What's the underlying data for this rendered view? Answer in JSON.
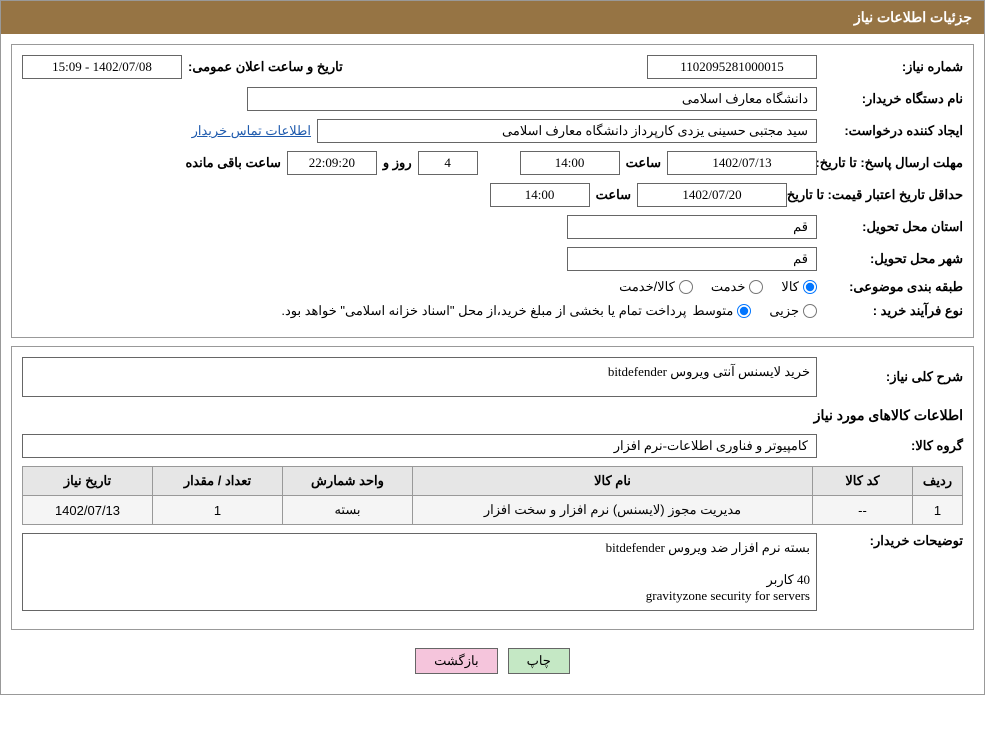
{
  "header": {
    "title": "جزئیات اطلاعات نیاز"
  },
  "info": {
    "request_no_label": "شماره نیاز:",
    "request_no": "1102095281000015",
    "announce_label": "تاریخ و ساعت اعلان عمومی:",
    "announce_value": "1402/07/08 - 15:09",
    "buyer_org_label": "نام دستگاه خریدار:",
    "buyer_org": "دانشگاه معارف اسلامی",
    "creator_label": "ایجاد کننده درخواست:",
    "creator": "سید مجتبی حسینی یزدی کارپرداز دانشگاه معارف اسلامی",
    "contact_link": "اطلاعات تماس خریدار",
    "reply_deadline_label": "مهلت ارسال پاسخ: تا تاریخ:",
    "reply_date": "1402/07/13",
    "time_label": "ساعت",
    "reply_time": "14:00",
    "days_label": "روز و",
    "days": "4",
    "remaining_time": "22:09:20",
    "remaining_label": "ساعت باقی مانده",
    "price_validity_label": "حداقل تاریخ اعتبار قیمت: تا تاریخ:",
    "price_date": "1402/07/20",
    "price_time": "14:00",
    "province_label": "استان محل تحویل:",
    "province": "قم",
    "city_label": "شهر محل تحویل:",
    "city": "قم",
    "category_label": "طبقه بندی موضوعی:",
    "radio_goods": "کالا",
    "radio_service": "خدمت",
    "radio_both": "کالا/خدمت",
    "buy_type_label": "نوع فرآیند خرید :",
    "radio_partial": "جزیی",
    "radio_medium": "متوسط",
    "buy_note": "پرداخت تمام یا بخشی از مبلغ خرید،از محل \"اسناد خزانه اسلامی\" خواهد بود."
  },
  "need": {
    "desc_label": "شرح کلی نیاز:",
    "desc": "خرید لایسنس آنتی ویروس bitdefender",
    "items_title": "اطلاعات کالاهای مورد نیاز",
    "group_label": "گروه کالا:",
    "group": "کامپیوتر و فناوری اطلاعات-نرم افزار",
    "buyer_desc_label": "توضیحات خریدار:",
    "buyer_desc": "بسته نرم افزار ضد ویروس bitdefender\n\n40 کاربر\ngravityzone security for servers"
  },
  "table": {
    "headers": [
      "ردیف",
      "کد کالا",
      "نام کالا",
      "واحد شمارش",
      "تعداد / مقدار",
      "تاریخ نیاز"
    ],
    "rows": [
      {
        "row": "1",
        "code": "--",
        "name": "مدیریت مجوز (لایسنس) نرم افزار و سخت افزار",
        "unit": "بسته",
        "qty": "1",
        "date": "1402/07/13"
      }
    ]
  },
  "buttons": {
    "print": "چاپ",
    "back": "بازگشت"
  }
}
